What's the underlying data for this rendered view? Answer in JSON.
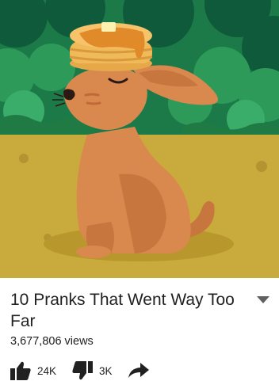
{
  "video": {
    "title": "10 Pranks That Went Way Too Far",
    "views": "3,677,806 views"
  },
  "actions": {
    "like_count": "24K",
    "dislike_count": "3K"
  },
  "icons": {
    "expand": "chevron-down-icon",
    "like": "thumbs-up-icon",
    "dislike": "thumbs-down-icon",
    "share": "share-arrow-icon"
  },
  "colors": {
    "sky_foliage": "#1e8a52",
    "ground": "#c9aa3c",
    "rabbit": "#d9884e",
    "text": "#212121"
  }
}
